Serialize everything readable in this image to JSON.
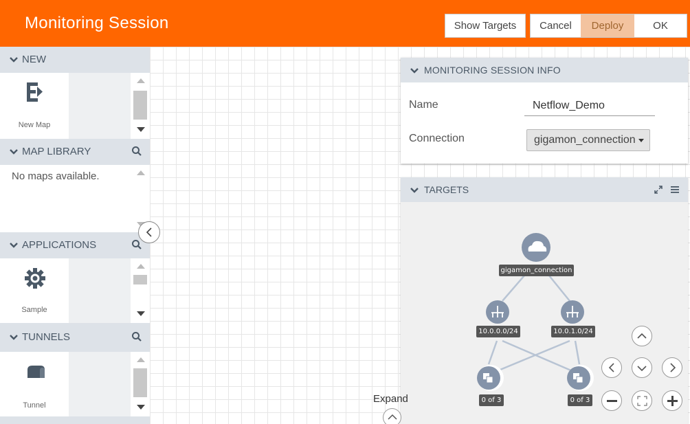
{
  "header": {
    "title": "Monitoring Session",
    "buttons": {
      "show_targets": "Show Targets",
      "cancel": "Cancel",
      "deploy": "Deploy",
      "ok": "OK"
    },
    "accent_color": "#ff6600"
  },
  "sidebar": {
    "new": {
      "title": "NEW",
      "tile_label": "New Map"
    },
    "map_library": {
      "title": "MAP LIBRARY",
      "empty_text": "No maps available."
    },
    "applications": {
      "title": "APPLICATIONS",
      "tile_label": "Sample"
    },
    "tunnels": {
      "title": "TUNNELS",
      "tile_label": "Tunnel"
    }
  },
  "info_panel": {
    "title": "MONITORING SESSION INFO",
    "name_label": "Name",
    "name_value": "Netflow_Demo",
    "connection_label": "Connection",
    "connection_value": "gigamon_connection"
  },
  "targets_panel": {
    "title": "TARGETS",
    "root_node": "gigamon_connection",
    "subnets": [
      "10.0.0.0/24",
      "10.0.1.0/24"
    ],
    "groups": [
      "0 of 3",
      "0 of 3"
    ]
  },
  "canvas": {
    "expand_label": "Expand"
  }
}
